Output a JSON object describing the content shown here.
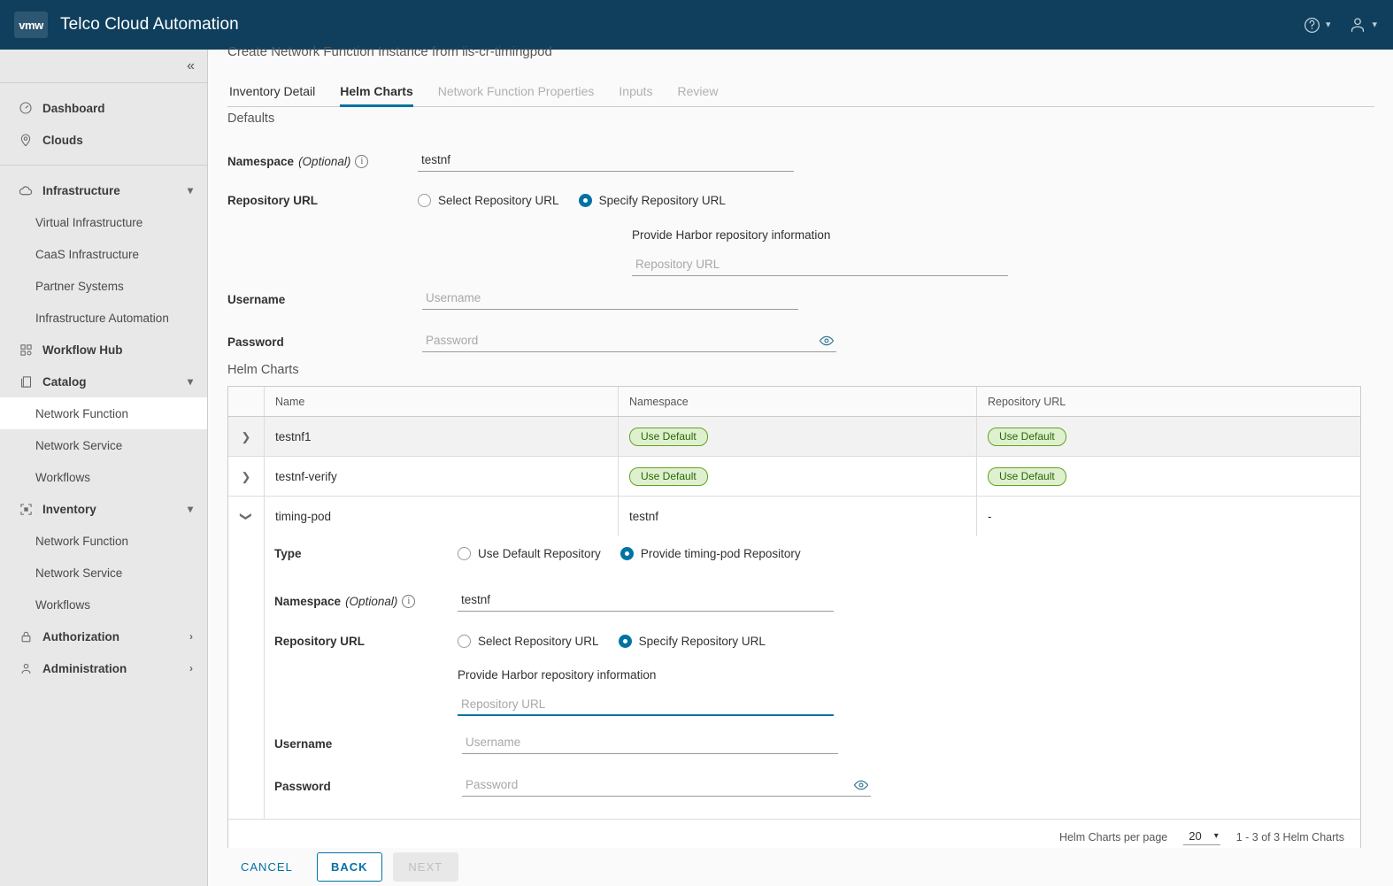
{
  "header": {
    "logo_text": "vmw",
    "title": "Telco Cloud Automation",
    "help_icon": "help-circle-icon",
    "user_icon": "user-icon"
  },
  "sidebar": {
    "collapse_icon": "double-chevron-left-icon",
    "groups": [
      {
        "items": [
          {
            "label": "Dashboard",
            "icon": "dashboard-icon",
            "level": "top"
          },
          {
            "label": "Clouds",
            "icon": "location-pin-icon",
            "level": "top"
          }
        ]
      },
      {
        "items": [
          {
            "label": "Infrastructure",
            "icon": "cloud-icon",
            "level": "top",
            "caret": "chevron-down-icon"
          },
          {
            "label": "Virtual Infrastructure",
            "level": "sub"
          },
          {
            "label": "CaaS Infrastructure",
            "level": "sub"
          },
          {
            "label": "Partner Systems",
            "level": "sub"
          },
          {
            "label": "Infrastructure Automation",
            "level": "sub"
          },
          {
            "label": "Workflow Hub",
            "icon": "grid-nodes-icon",
            "level": "top"
          },
          {
            "label": "Catalog",
            "icon": "catalog-icon",
            "level": "top",
            "caret": "chevron-down-icon"
          },
          {
            "label": "Network Function",
            "level": "sub",
            "active": true
          },
          {
            "label": "Network Service",
            "level": "sub"
          },
          {
            "label": "Workflows",
            "level": "sub"
          },
          {
            "label": "Inventory",
            "icon": "inventory-icon",
            "level": "top",
            "caret": "chevron-down-icon"
          },
          {
            "label": "Network Function",
            "level": "sub"
          },
          {
            "label": "Network Service",
            "level": "sub"
          },
          {
            "label": "Workflows",
            "level": "sub"
          },
          {
            "label": "Authorization",
            "icon": "lock-icon",
            "level": "top",
            "caret": "chevron-right-icon"
          },
          {
            "label": "Administration",
            "icon": "person-icon",
            "level": "top",
            "caret": "chevron-right-icon"
          }
        ]
      }
    ]
  },
  "wizard": {
    "title": "Create Network Function Instance from iis-cr-timingpod",
    "tabs": [
      {
        "label": "Inventory Detail",
        "state": "enabled"
      },
      {
        "label": "Helm Charts",
        "state": "active"
      },
      {
        "label": "Network Function Properties",
        "state": "disabled"
      },
      {
        "label": "Inputs",
        "state": "disabled"
      },
      {
        "label": "Review",
        "state": "disabled"
      }
    ]
  },
  "defaults": {
    "section_title": "Defaults",
    "namespace": {
      "label": "Namespace",
      "optional": "(Optional)",
      "info_icon": "info-circle-icon",
      "value": "testnf"
    },
    "repository_url": {
      "label": "Repository URL",
      "options": [
        {
          "label": "Select Repository URL",
          "selected": false
        },
        {
          "label": "Specify Repository URL",
          "selected": true
        }
      ],
      "hint": "Provide Harbor repository information",
      "input_placeholder": "Repository URL",
      "input_value": ""
    },
    "username": {
      "label": "Username",
      "placeholder": "Username",
      "value": ""
    },
    "password": {
      "label": "Password",
      "placeholder": "Password",
      "value": "",
      "reveal_icon": "eye-icon"
    }
  },
  "helm_charts": {
    "section_title": "Helm Charts",
    "columns": [
      "Name",
      "Namespace",
      "Repository URL"
    ],
    "rows": [
      {
        "name": "testnf1",
        "namespace_badge": "Use Default",
        "repository_badge": "Use Default",
        "expanded": false
      },
      {
        "name": "testnf-verify",
        "namespace_badge": "Use Default",
        "repository_badge": "Use Default",
        "expanded": false
      },
      {
        "name": "timing-pod",
        "namespace": "testnf",
        "repository": "-",
        "expanded": true
      }
    ],
    "expanded_detail": {
      "type": {
        "label": "Type",
        "options": [
          {
            "label": "Use Default Repository",
            "selected": false
          },
          {
            "label": "Provide timing-pod Repository",
            "selected": true
          }
        ]
      },
      "namespace": {
        "label": "Namespace",
        "optional": "(Optional)",
        "info_icon": "info-circle-icon",
        "value": "testnf"
      },
      "repository_url": {
        "label": "Repository URL",
        "options": [
          {
            "label": "Select Repository URL",
            "selected": false
          },
          {
            "label": "Specify Repository URL",
            "selected": true
          }
        ],
        "hint": "Provide Harbor repository information",
        "input_placeholder": "Repository URL",
        "input_value": "",
        "focused": true
      },
      "username": {
        "label": "Username",
        "placeholder": "Username",
        "value": ""
      },
      "password": {
        "label": "Password",
        "placeholder": "Password",
        "value": "",
        "reveal_icon": "eye-icon"
      }
    },
    "pagination": {
      "per_page_label": "Helm Charts per page",
      "per_page_value": "20",
      "caret_icon": "chevron-down-icon",
      "range_text": "1 - 3 of 3 Helm Charts"
    }
  },
  "footer": {
    "cancel": "CANCEL",
    "back": "BACK",
    "next": "NEXT"
  },
  "colors": {
    "header_bg": "#0f3f5d",
    "accent": "#0072a3",
    "badge_bg": "#dff0d0",
    "badge_border": "#62a420",
    "badge_text": "#266900",
    "sidebar_bg": "#e8e8e8"
  }
}
